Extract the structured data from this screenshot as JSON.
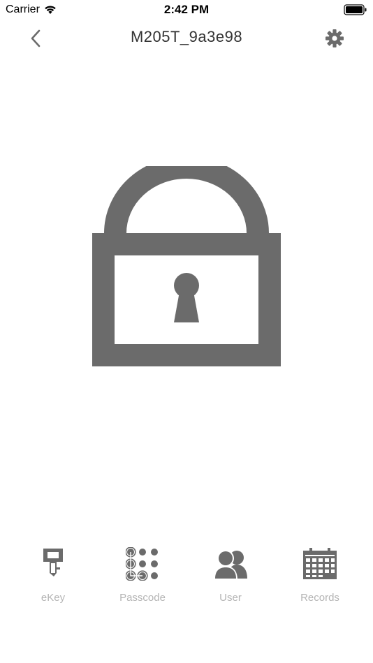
{
  "status_bar": {
    "carrier": "Carrier",
    "time": "2:42 PM"
  },
  "nav": {
    "title": "M205T_9a3e98",
    "back_icon": "chevron-left-icon",
    "settings_icon": "gear-icon"
  },
  "lock": {
    "icon": "lock-icon",
    "color": "#6b6b6b"
  },
  "tabs": [
    {
      "label": "eKey",
      "icon": "key-icon"
    },
    {
      "label": "Passcode",
      "icon": "passcode-grid-icon"
    },
    {
      "label": "User",
      "icon": "users-icon"
    },
    {
      "label": "Records",
      "icon": "calendar-icon"
    }
  ],
  "colors": {
    "icon_gray": "#6b6b6b",
    "label_gray": "#b4b4b4",
    "title": "#333333"
  }
}
